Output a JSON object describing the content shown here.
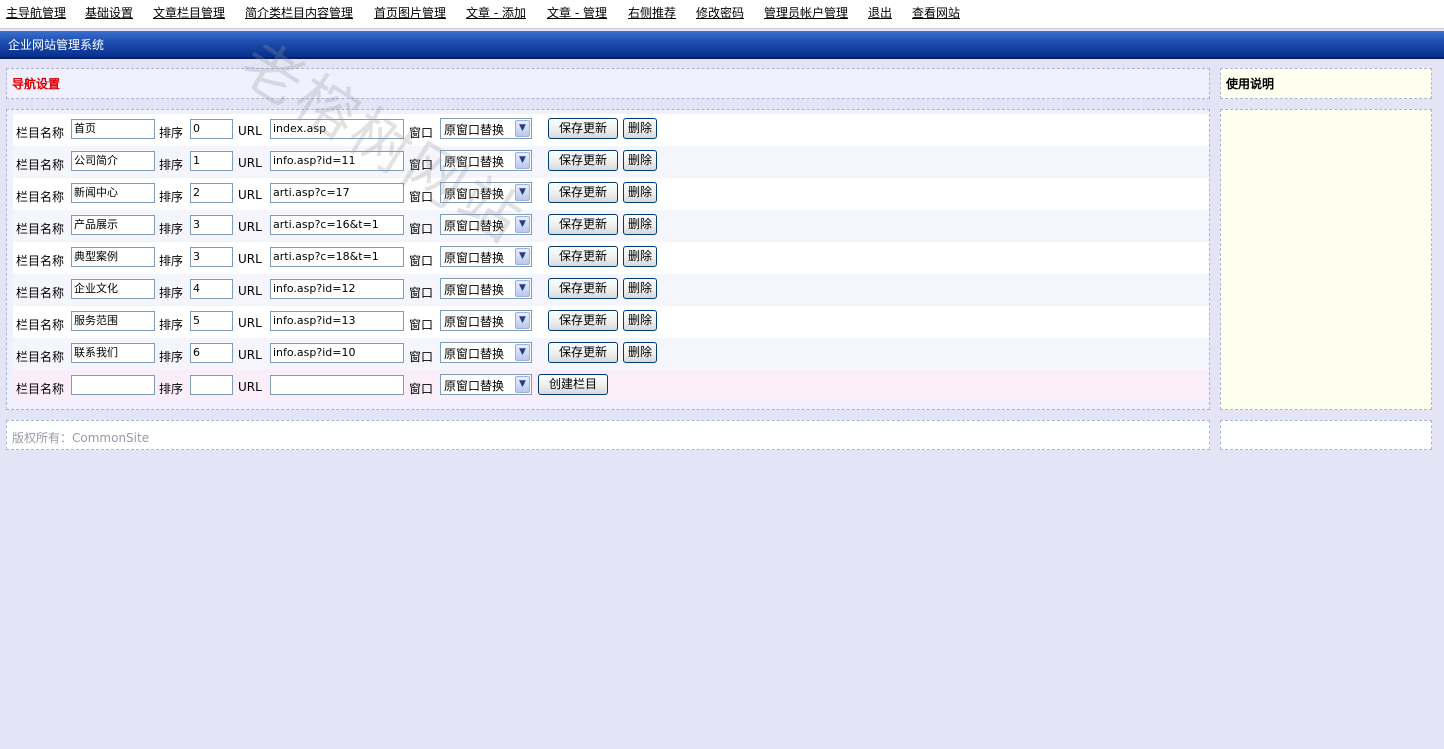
{
  "topnav": [
    "主导航管理",
    "基础设置",
    "文章栏目管理",
    "简介类栏目内容管理",
    "首页图片管理",
    "文章 - 添加",
    "文章 - 管理",
    "右侧推荐",
    "修改密码",
    "管理员帐户管理",
    "退出",
    "查看网站"
  ],
  "app_title": "企业网站管理系统",
  "section_title": "导航设置",
  "help_title": "使用说明",
  "footer": "版权所有：CommonSite",
  "watermark": "老榕树网站",
  "labels": {
    "name": "栏目名称",
    "order": "排序",
    "url": "URL",
    "window": "窗口",
    "save": "保存更新",
    "delete": "删除",
    "create": "创建栏目"
  },
  "rows": [
    {
      "name": "首页",
      "order": "0",
      "url": "index.asp",
      "window": "原窗口替换"
    },
    {
      "name": "公司简介",
      "order": "1",
      "url": "info.asp?id=11",
      "window": "原窗口替换"
    },
    {
      "name": "新闻中心",
      "order": "2",
      "url": "arti.asp?c=17",
      "window": "原窗口替换"
    },
    {
      "name": "产品展示",
      "order": "3",
      "url": "arti.asp?c=16&t=1",
      "window": "原窗口替换"
    },
    {
      "name": "典型案例",
      "order": "3",
      "url": "arti.asp?c=18&t=1",
      "window": "原窗口替换"
    },
    {
      "name": "企业文化",
      "order": "4",
      "url": "info.asp?id=12",
      "window": "原窗口替换"
    },
    {
      "name": "服务范围",
      "order": "5",
      "url": "info.asp?id=13",
      "window": "原窗口替换"
    },
    {
      "name": "联系我们",
      "order": "6",
      "url": "info.asp?id=10",
      "window": "原窗口替换"
    }
  ],
  "new_row": {
    "name": "",
    "order": "",
    "url": "",
    "window": "原窗口替换"
  }
}
